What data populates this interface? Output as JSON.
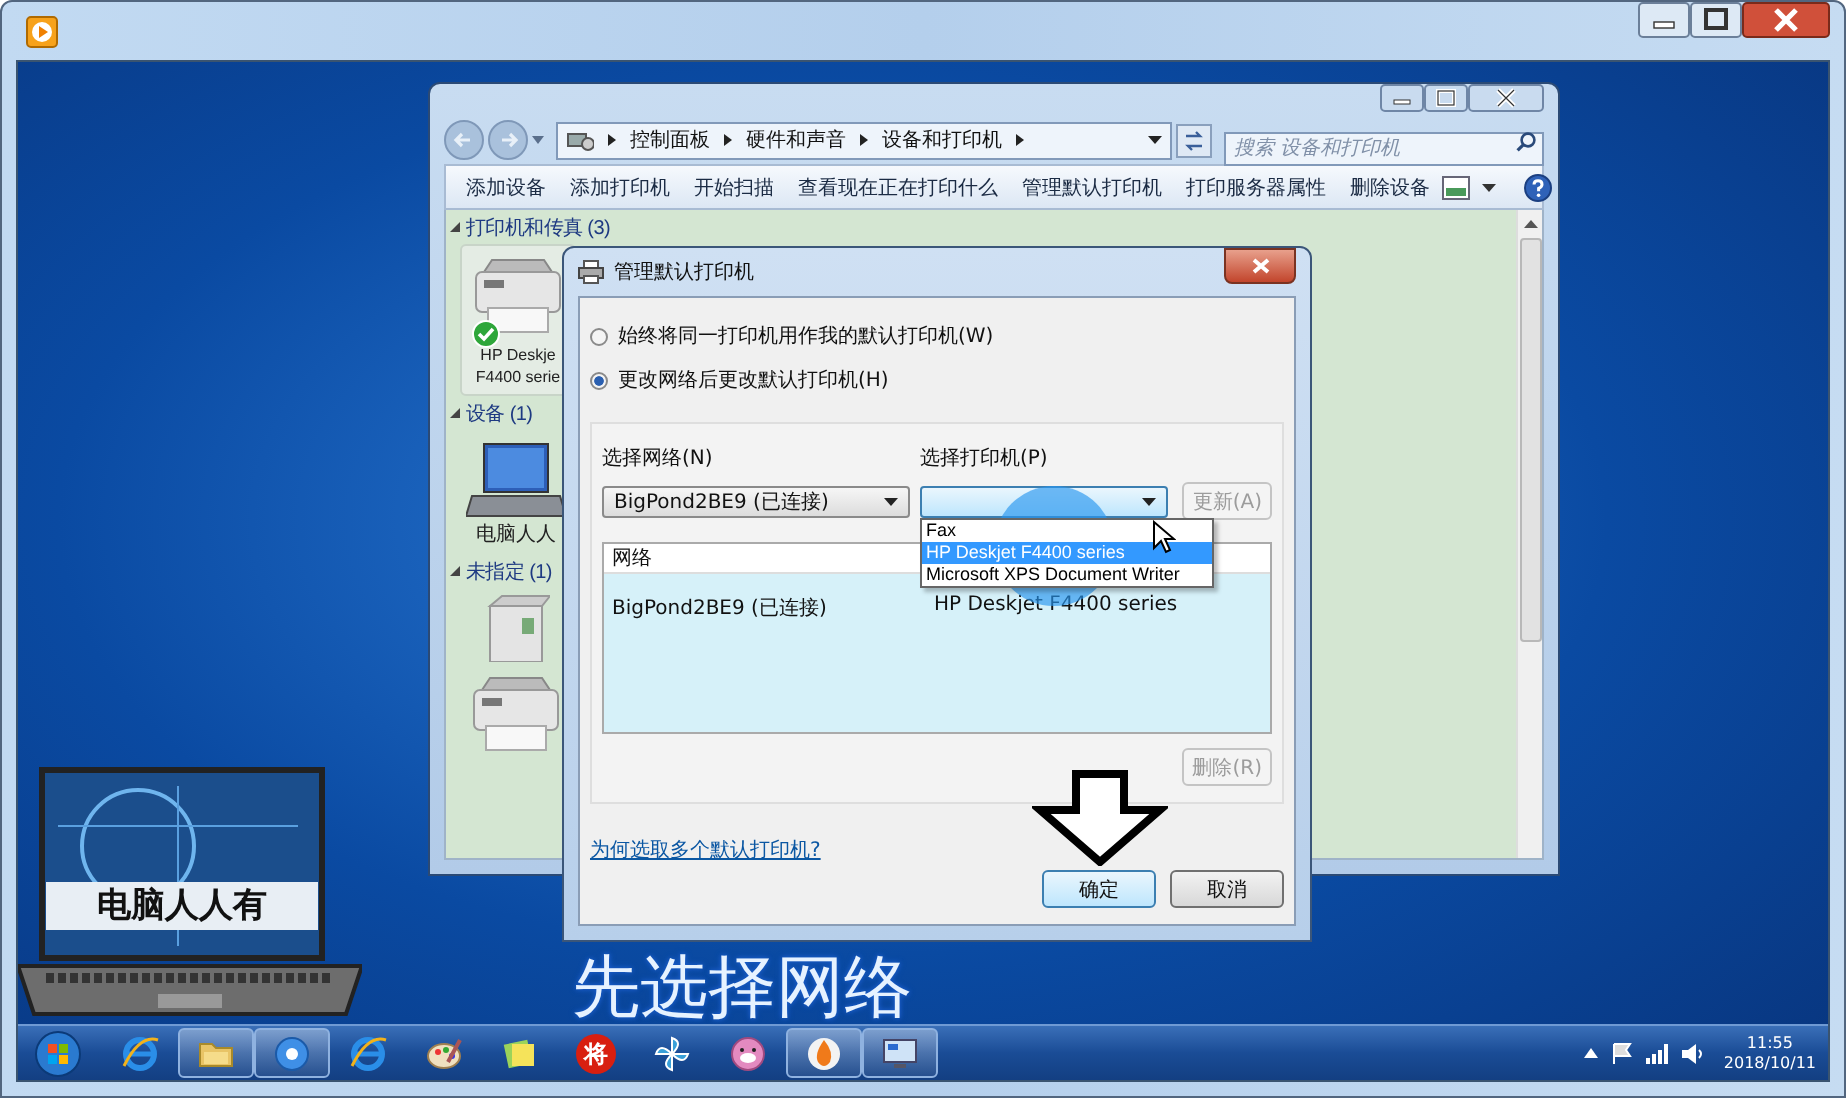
{
  "player": {
    "subtitle": "先选择网络",
    "logo_text": "电脑人人有"
  },
  "explorer": {
    "breadcrumb": [
      "控制面板",
      "硬件和声音",
      "设备和打印机"
    ],
    "search_placeholder": "搜索 设备和打印机",
    "toolbar": [
      "添加设备",
      "添加打印机",
      "开始扫描",
      "查看现在正在打印什么",
      "管理默认打印机",
      "打印服务器属性",
      "删除设备"
    ],
    "groups": [
      {
        "title": "打印机和传真 (3)",
        "expanded": true,
        "items": [
          {
            "kind": "printer",
            "label": "HP Deskje\nF4400 serie",
            "default": true
          }
        ]
      },
      {
        "title": "设备 (1)",
        "expanded": true,
        "items": [
          {
            "kind": "laptop",
            "label": "电脑人人",
            "default": false
          }
        ]
      },
      {
        "title": "未指定 (1)",
        "expanded": true,
        "items": [
          {
            "kind": "box",
            "default": false
          },
          {
            "kind": "printer",
            "default": false
          }
        ]
      }
    ]
  },
  "dialog": {
    "title": "管理默认打印机",
    "radios": [
      {
        "label": "始终将同一打印机用作我的默认打印机(W)",
        "selected": false
      },
      {
        "label": "更改网络后更改默认打印机(H)",
        "selected": true
      }
    ],
    "network_label": "选择网络(N)",
    "network_value": "BigPond2BE9 (已连接)",
    "printer_label": "选择打印机(P)",
    "update_button": {
      "label": "更新(A)",
      "disabled": true
    },
    "printer_options": [
      {
        "label": "Fax",
        "selected": false
      },
      {
        "label": "HP Deskjet F4400 series",
        "selected": true
      },
      {
        "label": "Microsoft XPS Document Writer",
        "selected": false
      }
    ],
    "table": {
      "columns": [
        "网络"
      ],
      "rows": [
        [
          "BigPond2BE9 (已连接)",
          "HP Deskjet F4400 series"
        ]
      ]
    },
    "remove_button": {
      "label": "删除(R)",
      "disabled": true
    },
    "link": "为何选取多个默认打印机?",
    "buttons": [
      {
        "label": "确定",
        "default": true
      },
      {
        "label": "取消",
        "default": false
      }
    ]
  },
  "taskbar": {
    "apps": [
      {
        "kind": "ie",
        "running": false
      },
      {
        "kind": "folder",
        "running": true
      },
      {
        "kind": "media",
        "running": true
      },
      {
        "kind": "ie",
        "running": false
      },
      {
        "kind": "paint",
        "running": false
      },
      {
        "kind": "notes",
        "running": false
      },
      {
        "kind": "glyph",
        "text": "将",
        "running": false
      },
      {
        "kind": "pinwheel",
        "running": false
      },
      {
        "kind": "pig",
        "running": false
      },
      {
        "kind": "fire",
        "running": true
      },
      {
        "kind": "monitor",
        "running": true
      }
    ],
    "time": "11:55",
    "date": "2018/10/11"
  }
}
